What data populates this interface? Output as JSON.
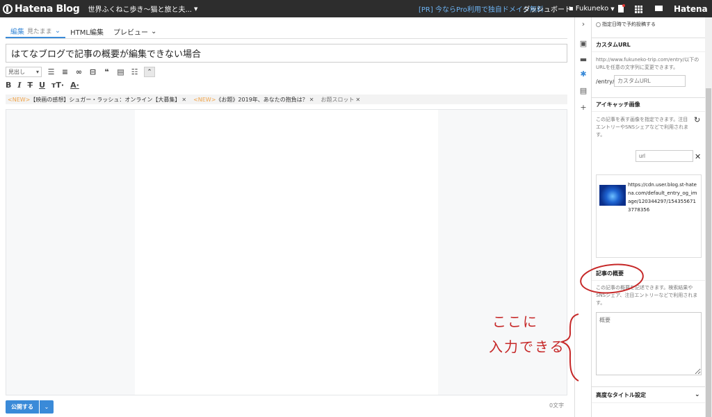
{
  "topbar": {
    "logo": "Hatena Blog",
    "blog_title": "世界ふくねこ歩き〜猫と旅と夫...",
    "pr_link": "[PR] 今ならPro利用で独自ドメイン無料",
    "dashboard": "ダッシュボード",
    "user": "Fukuneko",
    "hatena": "Hatena",
    "colors": {
      "bar_bg": "#2d2d2d",
      "link": "#6db3f2"
    }
  },
  "editor": {
    "tabs": [
      {
        "label": "編集",
        "sub": "見たまま"
      },
      {
        "label": "HTML編集"
      },
      {
        "label": "プレビュー"
      }
    ],
    "title_value": "はてなブログで記事の概要が編集できない場合",
    "heading_select": "見出し",
    "tag_bar": [
      {
        "prefix": "<NEW>",
        "text": "【映画の感想】シュガー・ラッシュ：オンライン【大募集】"
      },
      {
        "prefix": "<NEW>",
        "text": "《お題》2019年、あなたの抱負は？"
      },
      {
        "prefix": "",
        "text": "お題スロット"
      }
    ],
    "publish_label": "公開する",
    "char_count": "0文字",
    "accent": "#3a8ad8"
  },
  "rail_icons": [
    "chevron-right-icon",
    "photo-icon",
    "folder-icon",
    "gear-icon",
    "document-icon",
    "plus-icon"
  ],
  "sidebar": {
    "schedule_label": "指定日時で予約投稿する",
    "custom_url": {
      "title": "カスタムURL",
      "desc": "http://www.fukuneko-trip.com/entry/以下のURLを任意の文字列に変更できます。",
      "prefix": "/entry/",
      "placeholder": "カスタムURL"
    },
    "eyecatch": {
      "title": "アイキャッチ画像",
      "desc": "この記事を表す画像を指定できます。注目エントリーやSNSシェアなどで利用されます。",
      "url_placeholder": "url",
      "image_url": "https://cdn.user.blog.st-hatena.com/default_entry_og_image/120344297/1543556713778356"
    },
    "summary": {
      "title": "記事の概要",
      "desc": "この記事の概要を記述できます。検索結果やSNSシェア、注目エントリーなどで利用されます。",
      "placeholder": "概要"
    },
    "advanced": {
      "title": "高度なタイトル設定"
    }
  },
  "annotation": {
    "line1": "ここに",
    "line2": "入力できる",
    "color": "#c62828"
  }
}
